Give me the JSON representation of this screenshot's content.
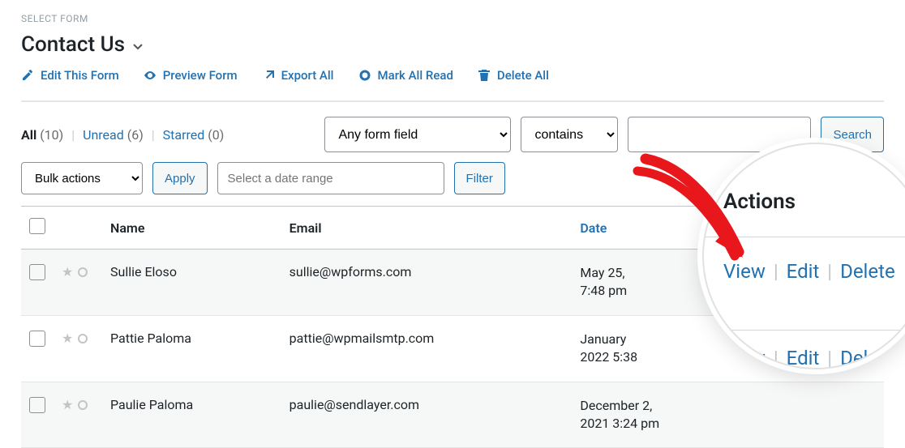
{
  "selectFormLabel": "SELECT FORM",
  "formTitle": "Contact Us",
  "toolbar": {
    "editForm": "Edit This Form",
    "previewForm": "Preview Form",
    "exportAll": "Export All",
    "markAllRead": "Mark All Read",
    "deleteAll": "Delete All"
  },
  "views": {
    "allLabel": "All",
    "allCount": "(10)",
    "unreadLabel": "Unread",
    "unreadCount": "(6)",
    "starredLabel": "Starred",
    "starredCount": "(0)"
  },
  "filters": {
    "fieldSelect": "Any form field",
    "condSelect": "contains",
    "searchBtn": "Search"
  },
  "bulk": {
    "select": "Bulk actions",
    "apply": "Apply",
    "dateRangePlaceholder": "Select a date range",
    "filter": "Filter"
  },
  "columns": {
    "name": "Name",
    "email": "Email",
    "date": "Date",
    "actions": "Actions"
  },
  "rows": [
    {
      "name": "Sullie Eloso",
      "email": "sullie@wpforms.com",
      "date1": "May 25,",
      "date2": "7:48 pm"
    },
    {
      "name": "Pattie Paloma",
      "email": "pattie@wpmailsmtp.com",
      "date1": "January",
      "date2": "2022 5:38"
    },
    {
      "name": "Paulie Paloma",
      "email": "paulie@sendlayer.com",
      "date1": "December 2,",
      "date2": "2021 3:24 pm"
    }
  ],
  "actions": {
    "title": "Actions",
    "view": "View",
    "edit": "Edit",
    "delete": "Delete"
  }
}
